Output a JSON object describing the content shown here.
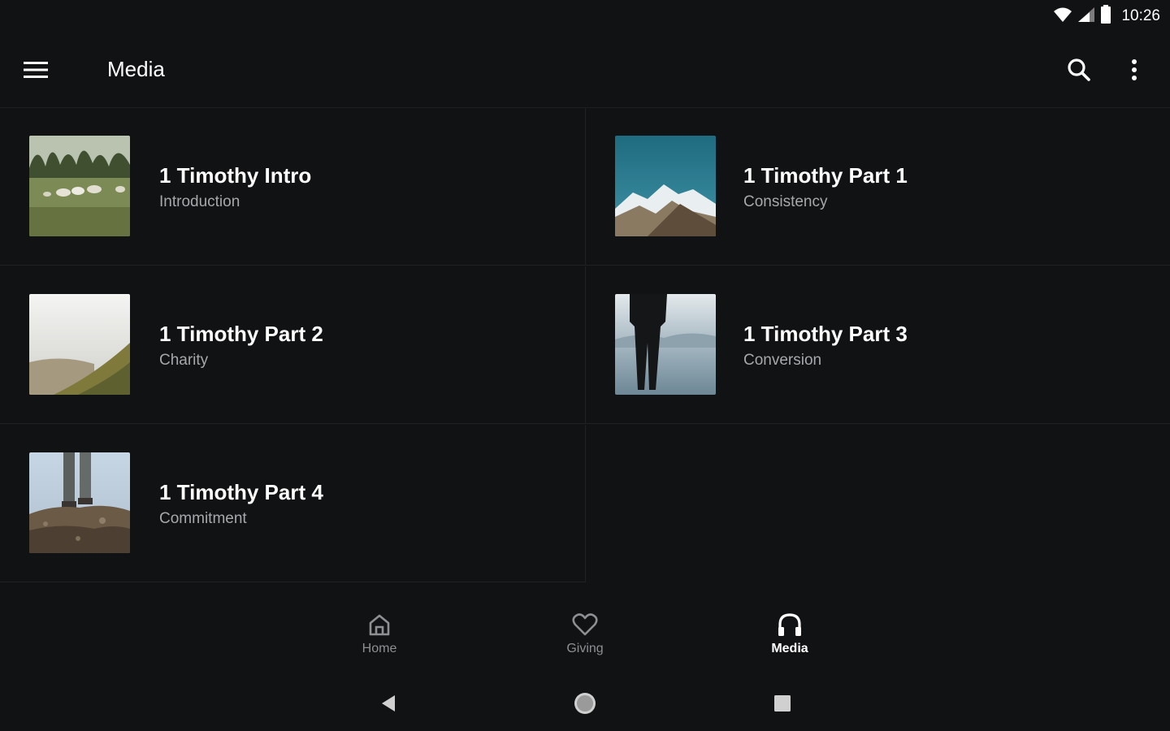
{
  "status_bar": {
    "time": "10:26",
    "icons": [
      "wifi-icon",
      "cell-signal-icon",
      "battery-icon"
    ]
  },
  "app_bar": {
    "title": "Media",
    "icons": [
      "menu-icon",
      "search-icon",
      "more-vert-icon"
    ]
  },
  "media_items": [
    {
      "title": "1 Timothy Intro",
      "subtitle": "Introduction",
      "thumbnail": "sheep-field"
    },
    {
      "title": "1 Timothy Part 1",
      "subtitle": "Consistency",
      "thumbnail": "snowy-mountains"
    },
    {
      "title": "1 Timothy Part 2",
      "subtitle": "Charity",
      "thumbnail": "misty-hillside"
    },
    {
      "title": "1 Timothy Part 3",
      "subtitle": "Conversion",
      "thumbnail": "person-by-lake"
    },
    {
      "title": "1 Timothy Part 4",
      "subtitle": "Commitment",
      "thumbnail": "legs-on-rocks"
    }
  ],
  "bottom_nav": [
    {
      "label": "Home",
      "icon": "home-icon",
      "active": false
    },
    {
      "label": "Giving",
      "icon": "heart-icon",
      "active": false
    },
    {
      "label": "Media",
      "icon": "headphones-icon",
      "active": true
    }
  ],
  "system_nav": [
    "back-icon",
    "home-circle-icon",
    "recents-icon"
  ],
  "colors": {
    "background": "#111214",
    "text_primary": "#ffffff",
    "text_secondary": "#a7a8ab",
    "divider": "#202124",
    "nav_inactive": "#8e8f93"
  }
}
